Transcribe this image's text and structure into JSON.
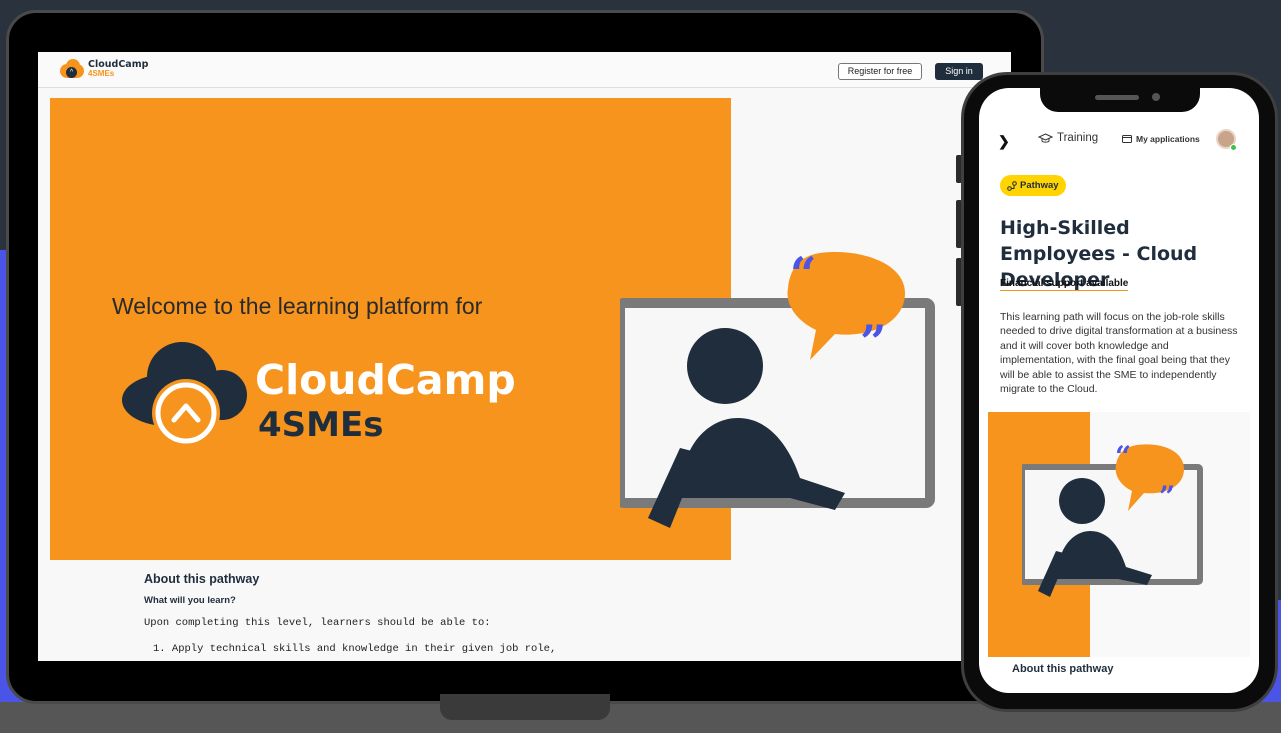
{
  "desktop": {
    "brand": {
      "name": "CloudCamp",
      "sub": "4SMEs"
    },
    "nav": {
      "register": "Register for free",
      "signin": "Sign in"
    },
    "hero": {
      "welcome": "Welcome to the learning platform for",
      "title": "CloudCamp",
      "subtitle": "4SMEs"
    },
    "about": {
      "title": "About this pathway",
      "subtitle": "What will you learn?",
      "intro": "Upon completing this level, learners should be able to:",
      "items": [
        "1. Apply technical skills and knowledge in their given job role,"
      ]
    }
  },
  "mobile": {
    "nav": {
      "training": "Training",
      "applications": "My applications"
    },
    "badge": "Pathway",
    "title": "High-Skilled Employees - Cloud Developer",
    "financial": "Financial support available",
    "description": "This learning path will focus on the job-role skills needed to drive digital transformation at a business and it will cover both knowledge and implementation, with the final goal being that they will be able to assist the SME to independently migrate to the Cloud.",
    "about": "About this pathway"
  },
  "colors": {
    "orange": "#f7941d",
    "navy": "#1f2d3d",
    "blue": "#4a54e6",
    "yellow": "#ffd400"
  },
  "icons": [
    "cloud-logo-icon",
    "chevron-up-icon",
    "person-icon",
    "quote-bubble-icon",
    "graduation-cap-icon",
    "window-icon",
    "pathway-icon",
    "avatar"
  ]
}
